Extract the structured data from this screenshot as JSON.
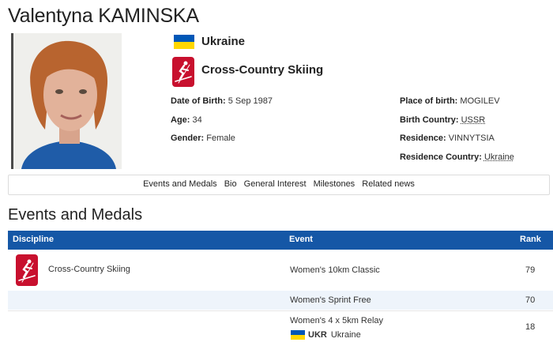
{
  "athlete": {
    "name": "Valentyna KAMINSKA",
    "country": "Ukraine",
    "sport": "Cross-Country Skiing"
  },
  "details": {
    "dob_label": "Date of Birth:",
    "dob_value": "5 Sep 1987",
    "age_label": "Age:",
    "age_value": "34",
    "gender_label": "Gender:",
    "gender_value": "Female",
    "pob_label": "Place of birth:",
    "pob_value": "MOGILEV",
    "birth_country_label": "Birth Country:",
    "birth_country_value": "USSR",
    "residence_label": "Residence:",
    "residence_value": "VINNYTSIA",
    "residence_country_label": "Residence Country:",
    "residence_country_value": "Ukraine"
  },
  "subnav": [
    "Events and Medals",
    "Bio",
    "General Interest",
    "Milestones",
    "Related news"
  ],
  "events_section": {
    "title": "Events and Medals",
    "columns": {
      "discipline": "Discipline",
      "event": "Event",
      "rank": "Rank"
    },
    "discipline": "Cross-Country Skiing",
    "rows": [
      {
        "event": "Women's 10km Classic",
        "rank": "79"
      },
      {
        "event": "Women's Sprint Free",
        "rank": "70"
      },
      {
        "event": "Women's 4 x 5km Relay",
        "rank": "18",
        "team_code": "UKR",
        "team_name": "Ukraine"
      }
    ]
  },
  "colors": {
    "accent_blue": "#1557a6",
    "sport_red": "#c8102e",
    "flag_blue": "#0057b7",
    "flag_yellow": "#ffd700"
  },
  "icons": {
    "sport": "cross-country-skiing-icon",
    "flag": "ukraine-flag-icon"
  }
}
